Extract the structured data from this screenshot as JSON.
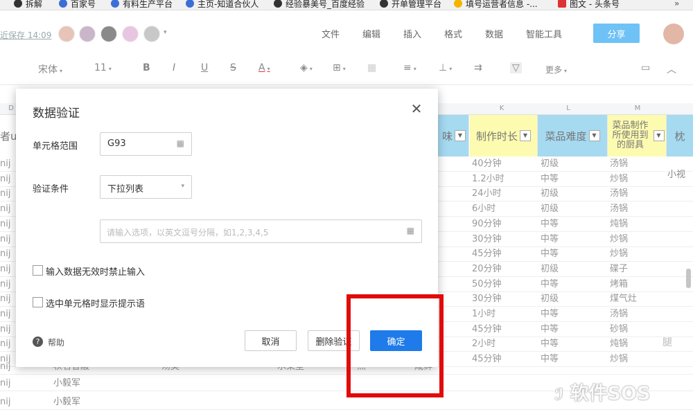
{
  "bookmarks": [
    "拆解",
    "百家号",
    "有料生产平台",
    "主页-知道合伙人",
    "经验暴美号_百度经验",
    "开单管理平台",
    "填号运营者信息 -...",
    "图文 - 头条号"
  ],
  "header": {
    "saved_status": "近保存 14:09",
    "menu": [
      "文件",
      "编辑",
      "插入",
      "格式",
      "数据",
      "智能工具"
    ],
    "share_label": "分享"
  },
  "toolbar": {
    "font_name": "宋体",
    "font_size": "11",
    "bold": "B",
    "italic": "I",
    "underline": "U",
    "strike": "S",
    "font_color": "A",
    "more": "更多"
  },
  "grid": {
    "column_letters": [
      "D",
      "K",
      "L",
      "M"
    ],
    "headers": {
      "left_partial": "者u",
      "taste_partial": "味",
      "time": "制作时长",
      "difficulty": "菜品难度",
      "tool": "菜品制作所使用到的厨具",
      "right_partial": "枕"
    },
    "row_left_label": "nij",
    "rows": [
      {
        "time": "40分钟",
        "difficulty": "初级",
        "tool": "汤锅"
      },
      {
        "time": "1.2小时",
        "difficulty": "中等",
        "tool": "炒锅"
      },
      {
        "time": "24小时",
        "difficulty": "初级",
        "tool": "汤锅"
      },
      {
        "time": "6小时",
        "difficulty": "初级",
        "tool": "汤锅"
      },
      {
        "time": "90分钟",
        "difficulty": "中等",
        "tool": "炖锅"
      },
      {
        "time": "30分钟",
        "difficulty": "中等",
        "tool": "炒锅"
      },
      {
        "time": "45分钟",
        "difficulty": "中等",
        "tool": "炒锅"
      },
      {
        "time": "20分钟",
        "difficulty": "初级",
        "tool": "碟子"
      },
      {
        "time": "50分钟",
        "difficulty": "中等",
        "tool": "烤箱"
      },
      {
        "time": "30分钟",
        "difficulty": "初级",
        "tool": "煤气灶"
      },
      {
        "time": "1小时",
        "difficulty": "中等",
        "tool": "汤锅"
      },
      {
        "time": "45分钟",
        "difficulty": "中等",
        "tool": "砂锅"
      },
      {
        "time": "2小时",
        "difficulty": "中等",
        "tool": "炖锅"
      },
      {
        "time": "45分钟",
        "difficulty": "中等",
        "tool": "炒锅"
      }
    ],
    "extra_cell": "小视",
    "partial_row": [
      "秋名香酸",
      "汤类",
      "水果型",
      "点",
      "咸鲜"
    ],
    "bottom_names": [
      "小毅军",
      "小毅军"
    ],
    "right_partial_char": "腿"
  },
  "dialog": {
    "title": "数据验证",
    "range_label": "单元格范围",
    "range_value": "G93",
    "condition_label": "验证条件",
    "condition_value": "下拉列表",
    "options_placeholder": "请输入选项，以英文逗号分隔，如1,2,3,4,5",
    "checkbox_reject": "输入数据无效时禁止输入",
    "checkbox_hint": "选中单元格时显示提示语",
    "help_label": "帮助",
    "cancel_label": "取消",
    "delete_label": "删除验证",
    "confirm_label": "确定"
  },
  "watermark": "软件SOS",
  "colors": {
    "primary": "#1f7bea",
    "share": "#6ec2f6",
    "highlight": "#e10b0b",
    "header_blue": "#a6daf1",
    "header_yellow": "#fdfbb0"
  }
}
